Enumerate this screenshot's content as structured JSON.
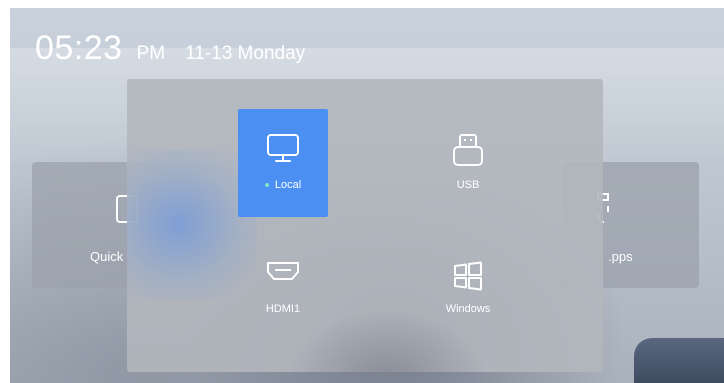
{
  "clock": {
    "time": "05:23",
    "ampm": "PM",
    "date": "11-13 Monday"
  },
  "background_tiles": [
    {
      "label": "Quick",
      "icon": "square-outline-icon"
    },
    {
      "label": ".pps",
      "icon": "apps-icon"
    }
  ],
  "signal_sources": {
    "items": [
      {
        "label": "Local",
        "icon": "monitor-icon",
        "selected": true
      },
      {
        "label": "USB",
        "icon": "usb-icon",
        "selected": false
      },
      {
        "label": "HDMI1",
        "icon": "hdmi-icon",
        "selected": false
      },
      {
        "label": "Windows",
        "icon": "windows-icon",
        "selected": false
      }
    ]
  },
  "colors": {
    "accent": "#4a8ff1",
    "active_dot": "#7fe3c8",
    "panel": "#b2b7be"
  }
}
